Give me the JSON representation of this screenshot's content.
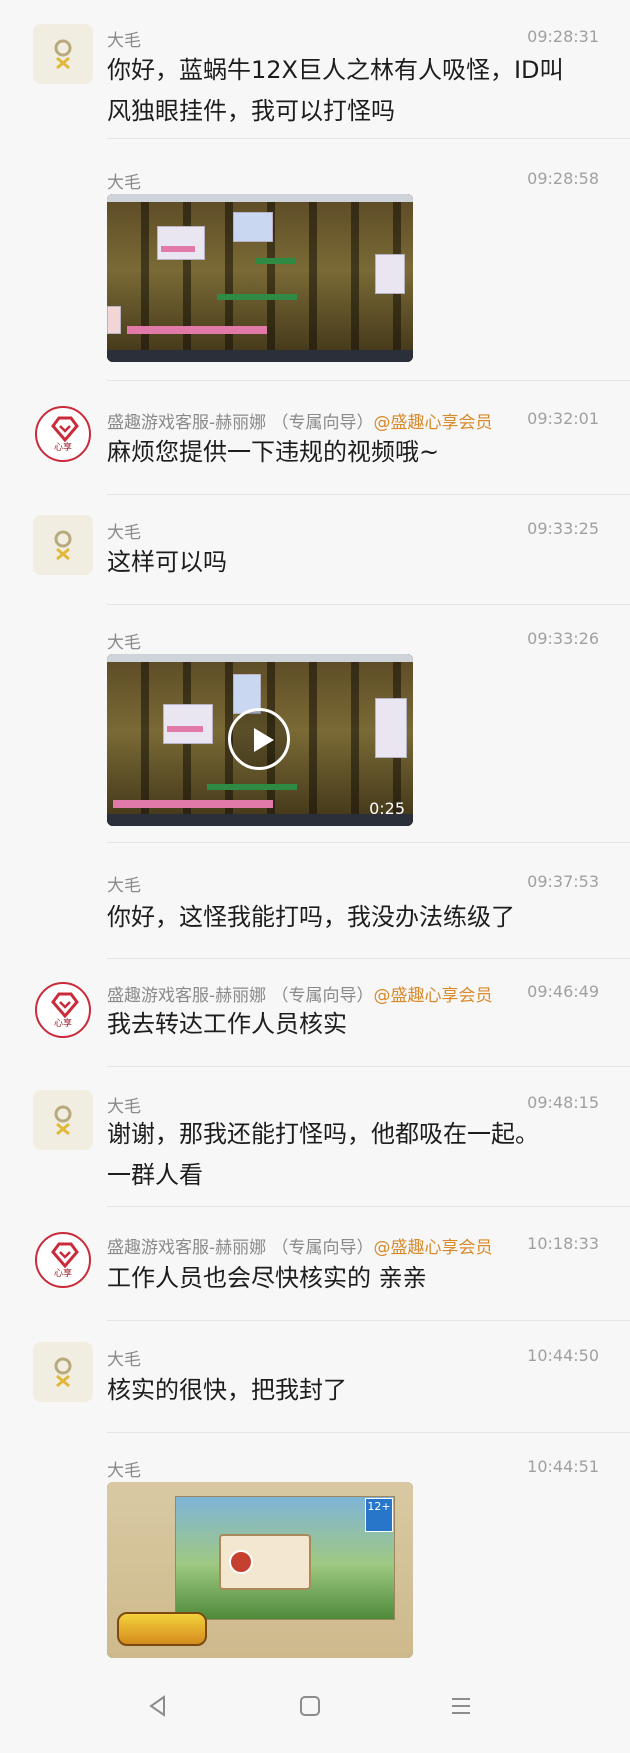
{
  "messages": [
    {
      "sender": "大毛",
      "time": "09:28:31",
      "text_lines": [
        "你好，蓝蜗牛12X巨人之林有人吸怪，ID叫",
        "风独眼挂件，我可以打怪吗"
      ]
    },
    {
      "sender": "大毛",
      "time": "09:28:58"
    },
    {
      "sender": "盛趣游戏客服-赫丽娜 （专属向导）",
      "vip": "@盛趣心享会员",
      "time": "09:32:01",
      "text_lines": [
        "麻烦您提供一下违规的视频哦~"
      ]
    },
    {
      "sender": "大毛",
      "time": "09:33:25",
      "text_lines": [
        "这样可以吗"
      ]
    },
    {
      "sender": "大毛",
      "time": "09:33:26",
      "duration": "0:25"
    },
    {
      "sender": "大毛",
      "time": "09:37:53",
      "text_lines": [
        "你好，这怪我能打吗，我没办法练级了"
      ]
    },
    {
      "sender": "盛趣游戏客服-赫丽娜 （专属向导）",
      "vip": "@盛趣心享会员",
      "time": "09:46:49",
      "text_lines": [
        "我去转达工作人员核实"
      ]
    },
    {
      "sender": "大毛",
      "time": "09:48:15",
      "text_lines": [
        "谢谢，那我还能打怪吗，他都吸在一起。",
        "一群人看"
      ]
    },
    {
      "sender": "盛趣游戏客服-赫丽娜 （专属向导）",
      "vip": "@盛趣心享会员",
      "time": "10:18:33",
      "text_lines": [
        "工作人员也会尽快核实的 亲亲"
      ]
    },
    {
      "sender": "大毛",
      "time": "10:44:50",
      "text_lines": [
        "核实的很快，把我封了"
      ]
    },
    {
      "sender": "大毛",
      "time": "10:44:51",
      "age_badge": "12+"
    }
  ],
  "cs_avatar_label": "心享",
  "nav": {
    "back": "back-icon",
    "home": "home-icon",
    "menu": "menu-icon"
  }
}
